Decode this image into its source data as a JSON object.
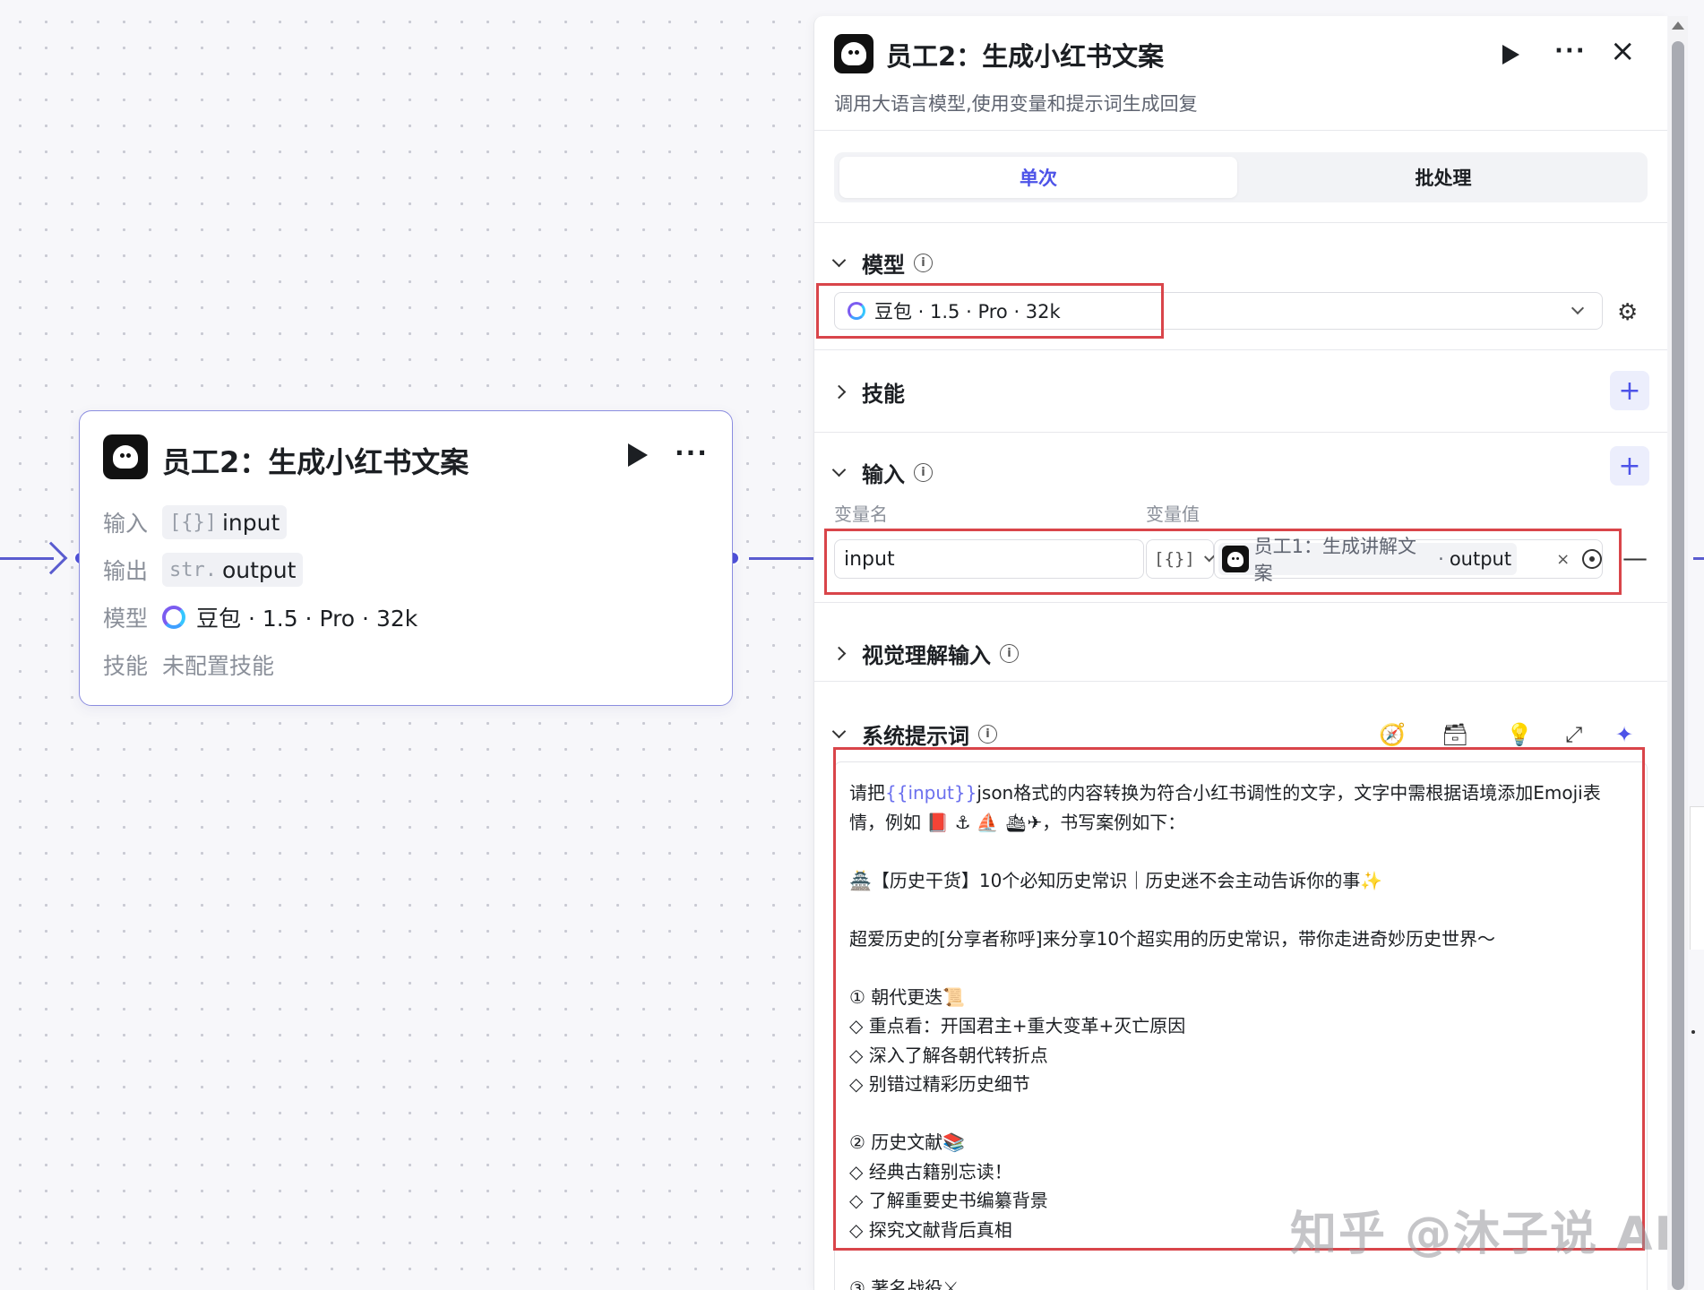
{
  "node": {
    "title": "员工2：生成小红书文案",
    "input_label": "输入",
    "input_type": "[{}]",
    "input_value": "input",
    "output_label": "输出",
    "output_type": "str.",
    "output_value": "output",
    "model_label": "模型",
    "model_value": "豆包 · 1.5 · Pro · 32k",
    "skill_label": "技能",
    "skill_value": "未配置技能"
  },
  "panel": {
    "title": "员工2：生成小红书文案",
    "description": "调用大语言模型,使用变量和提示词生成回复",
    "tabs": [
      {
        "label": "单次",
        "active": true
      },
      {
        "label": "批处理",
        "active": false
      }
    ],
    "model_section": {
      "title": "模型",
      "selected": "豆包 · 1.5 · Pro · 32k"
    },
    "skills_section": {
      "title": "技能"
    },
    "input_section": {
      "title": "输入",
      "col_name": "变量名",
      "col_value": "变量值",
      "var_name": "input",
      "var_type": "[{}]",
      "ref_node": "员工1：生成讲解文案",
      "ref_dot": "·",
      "ref_output": "output"
    },
    "vision_section": {
      "title": "视觉理解输入"
    },
    "prompt_section": {
      "title": "系统提示词",
      "prefix": "请把",
      "variable": "{{input}}",
      "body": "json格式的内容转换为符合小红书调性的文字，文字中需根据语境添加Emoji表情，例如 📕 ⚓ ⛵ 🛳✈，书写案例如下：\n\n🏯【历史干货】10个必知历史常识｜历史迷不会主动告诉你的事✨\n\n超爱历史的[分享者称呼]来分享10个超实用的历史常识，带你走进奇妙历史世界～\n\n① 朝代更迭📜\n◇ 重点看：开国君主+重大变革+灭亡原因\n◇ 深入了解各朝代转折点\n◇ 别错过精彩历史细节\n\n② 历史文献📚\n◇ 经典古籍别忘读！\n◇ 了解重要史书编纂背景\n◇ 探究文献背后真相\n\n③ 著名战役⚔"
    }
  },
  "watermark": "知乎 @沐子说 AI",
  "colors": {
    "accent": "#4d53e8",
    "highlight": "#d9454a",
    "edge": "#5a5ccf"
  }
}
